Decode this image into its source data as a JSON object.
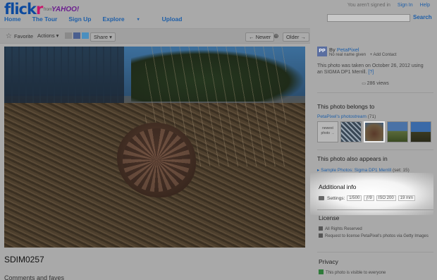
{
  "header": {
    "logo_main": "flick",
    "logo_r": "r",
    "from": "from",
    "yahoo": "YAHOO!",
    "nav": [
      "Home",
      "The Tour",
      "Sign Up",
      "Explore",
      "Upload"
    ],
    "explore_caret": "▾",
    "status_text": "You aren't signed in",
    "sign_in": "Sign In",
    "help": "Help",
    "search_label": "Search"
  },
  "toolbar": {
    "favorite": "Favorite",
    "actions": "Actions ▾",
    "share": "Share ▾",
    "newer": "← Newer",
    "older": "Older →"
  },
  "photo": {
    "title": "SDIM0257",
    "comments_heading": "Comments and faves"
  },
  "owner": {
    "by": "By ",
    "name": "PetaPixel",
    "real_name": "No real name given",
    "add_contact": "+ Add Contact",
    "buddy_initials": "PP",
    "taken_text": "This photo was taken on October 26, 2012 using an SIGMA DP1 Merrill.",
    "taken_ref": "[?]",
    "views": "286 views"
  },
  "belongs": {
    "heading": "This photo belongs to",
    "stream": "PetaPixel's photostream",
    "stream_count": "(71)",
    "newest_label": "newest photo →"
  },
  "appears": {
    "heading": "This photo also appears in",
    "set": "Sample Photos: Sigma DP1 Merrill",
    "set_count": "(set: 15)"
  },
  "additional": {
    "heading": "Additional info",
    "settings_label": "Settings:",
    "chips": [
      "1/500",
      "ƒ/9",
      "ISO 200",
      "19 mm"
    ]
  },
  "license": {
    "heading": "License",
    "rights": "All Rights Reserved",
    "request": "Request to license PetaPixel's photos via Getty Images"
  },
  "privacy": {
    "heading": "Privacy",
    "text": "This photo is visible to everyone"
  }
}
